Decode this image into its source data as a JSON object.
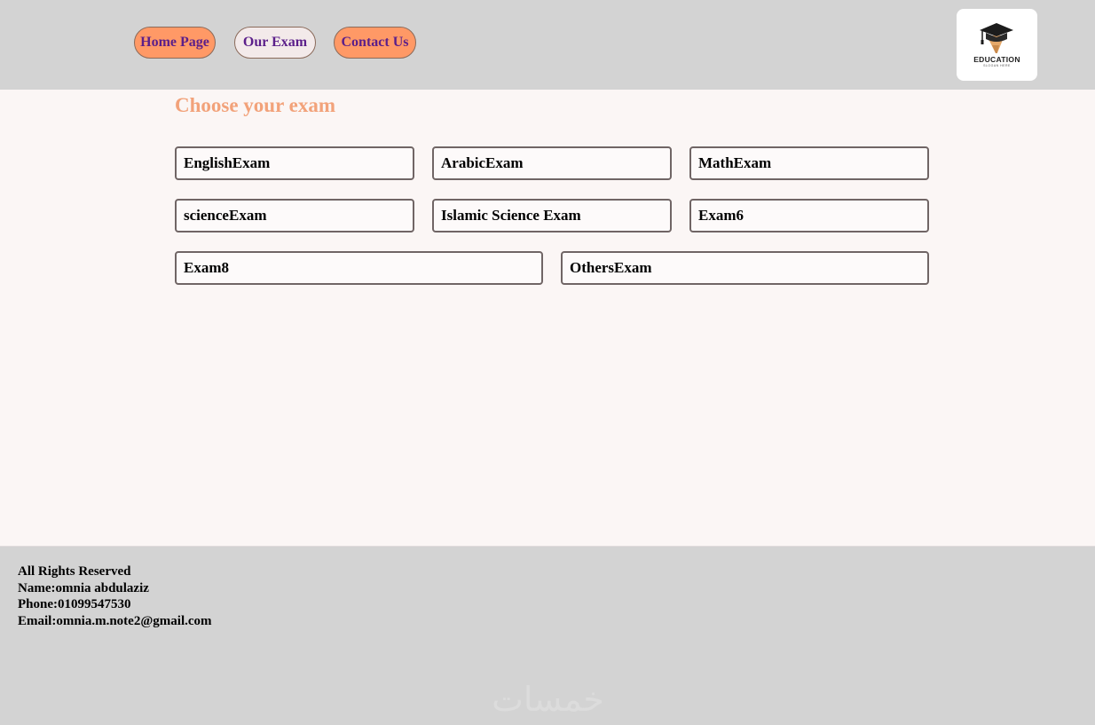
{
  "nav": {
    "home": "Home Page",
    "exam": "Our Exam",
    "contact": "Contact Us"
  },
  "logo": {
    "word": "EDUCATION",
    "slogan": "SLOGAN HERE"
  },
  "main": {
    "title": "Choose your exam",
    "exams": [
      "EnglishExam",
      "ArabicExam",
      "MathExam",
      "scienceExam",
      "Islamic Science Exam",
      "Exam6",
      "Exam8",
      "OthersExam"
    ]
  },
  "footer": {
    "lines": [
      "All Rights Reserved",
      "Name:omnia abdulaziz",
      "Phone:01099547530",
      "Email:omnia.m.note2@gmail.com"
    ],
    "watermark": "خمسات"
  },
  "colors": {
    "header_bg": "#d3d3d3",
    "page_bg": "#fbf6f5",
    "accent_orange": "#ff9966",
    "title_color": "#f2a27a",
    "nav_text": "#5b1f8a"
  },
  "icons": {
    "logo": "graduation-cap-pencil-icon"
  }
}
